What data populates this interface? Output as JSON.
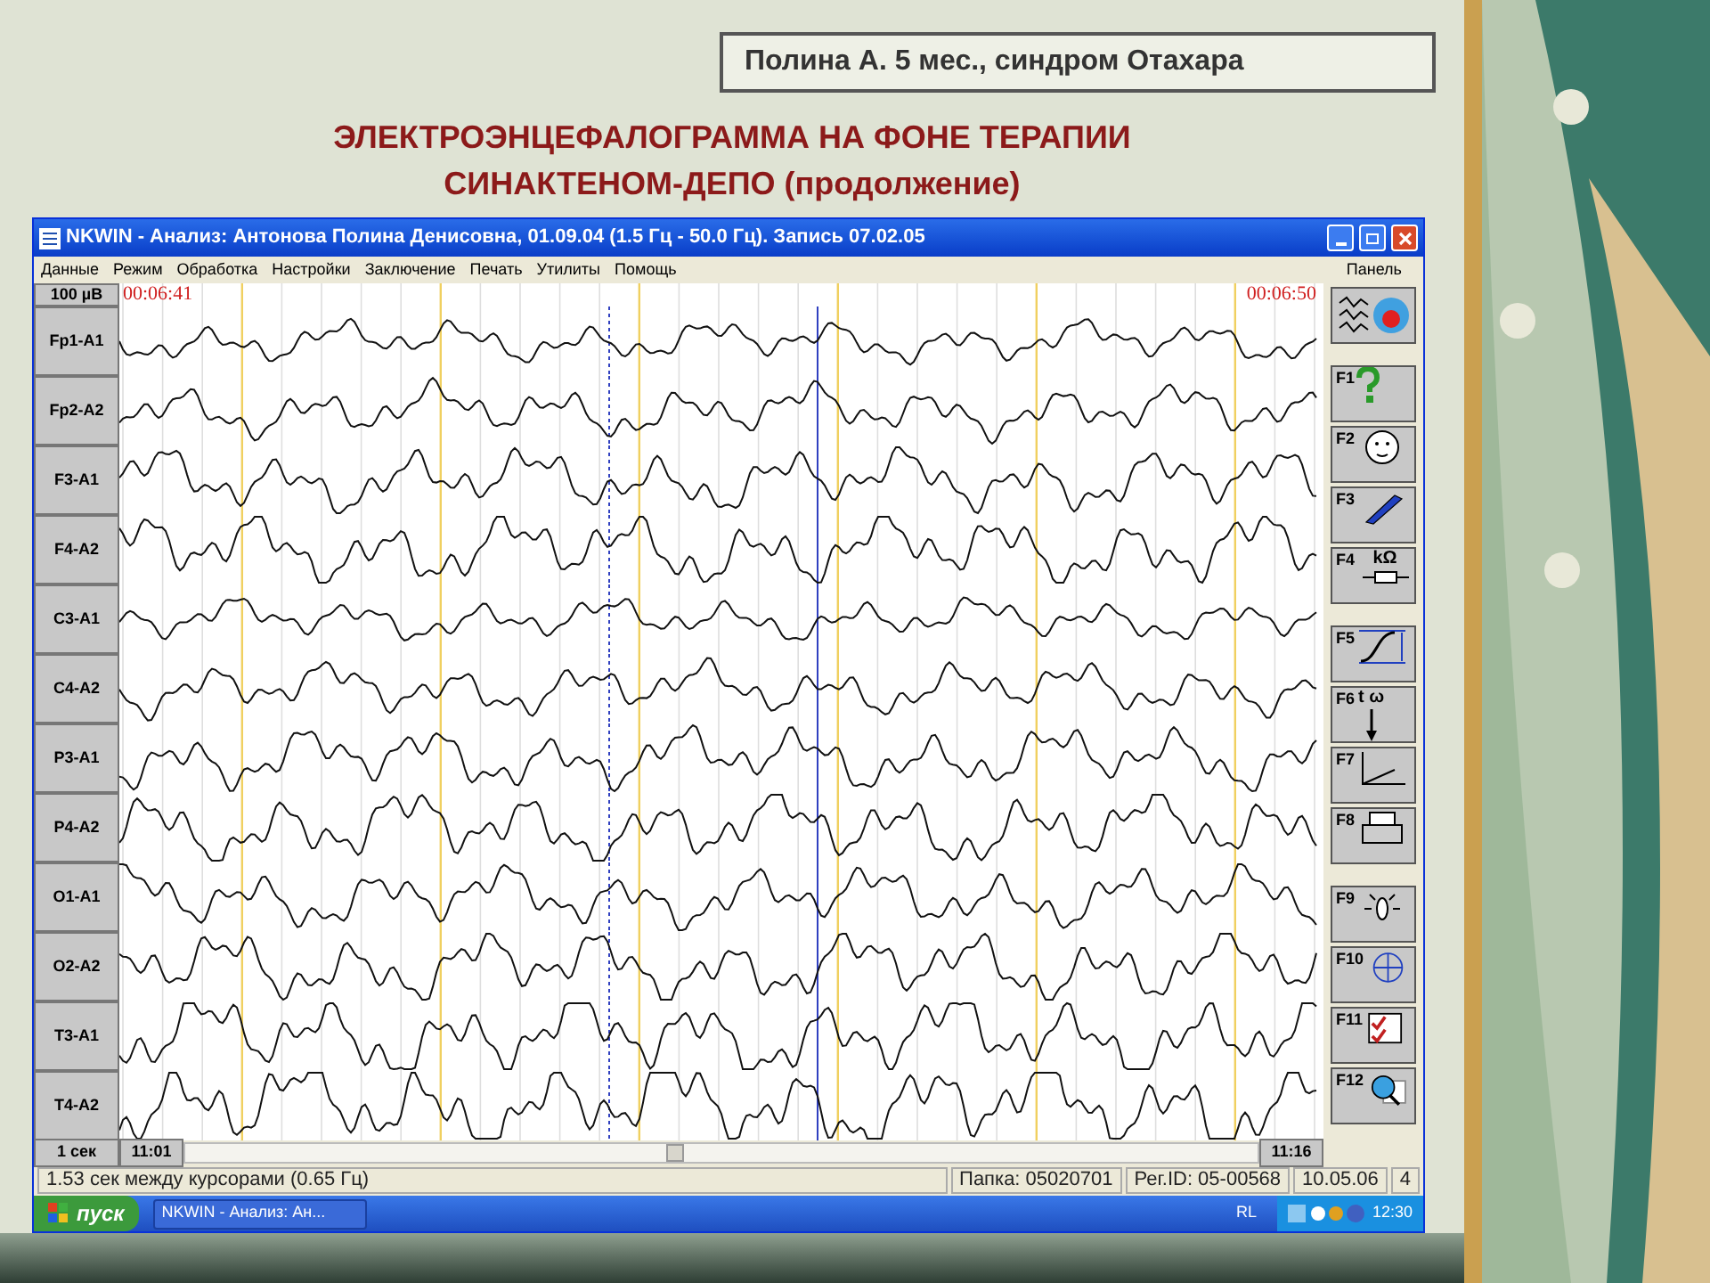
{
  "slide": {
    "caption": "Полина А. 5 мес., синдром Отахара",
    "title_lines": [
      "ЭЛЕКТРОЭНЦЕФАЛОГРАММА НА ФОНЕ ТЕРАПИИ",
      "СИНАКТЕНОМ-ДЕПО (продолжение)"
    ]
  },
  "window": {
    "title": "NKWIN - Анализ: Антонова Полина Денисовна, 01.09.04 (1.5 Гц - 50.0 Гц). Запись 07.02.05"
  },
  "menu": [
    "Данные",
    "Режим",
    "Обработка",
    "Настройки",
    "Заключение",
    "Печать",
    "Утилиты",
    "Помощь"
  ],
  "panel_label": "Панель",
  "scale": "100 µB",
  "time_start": "00:06:41",
  "time_end": "00:06:50",
  "channels": [
    "Fp1-A1",
    "Fp2-A2",
    "F3-A1",
    "F4-A2",
    "C3-A1",
    "C4-A2",
    "P3-A1",
    "P4-A2",
    "O1-A1",
    "O2-A2",
    "T3-A1",
    "T4-A2"
  ],
  "function_keys": [
    {
      "label": "F1",
      "kind": "help"
    },
    {
      "label": "F2",
      "kind": "face"
    },
    {
      "label": "F3",
      "kind": "pen"
    },
    {
      "label": "F4",
      "kind": "impedance",
      "icon_text": "kΩ"
    },
    {
      "label": "F5",
      "kind": "curve"
    },
    {
      "label": "F6",
      "kind": "timefreq",
      "icon_text": "t ω"
    },
    {
      "label": "F7",
      "kind": "axes"
    },
    {
      "label": "F8",
      "kind": "printer"
    },
    {
      "label": "F9",
      "kind": "light"
    },
    {
      "label": "F10",
      "kind": "globe"
    },
    {
      "label": "F11",
      "kind": "checklist"
    },
    {
      "label": "F12",
      "kind": "magnifier"
    }
  ],
  "timebase": "1 сек",
  "scroll_start": "11:01",
  "scroll_end": "11:16",
  "status": [
    "1.53 сек между курсорами (0.65 Гц)",
    "Папка: 05020701",
    "Рег.ID: 05-00568",
    "10.05.06",
    "4"
  ],
  "taskbar": {
    "start": "пуск",
    "tasks": [
      "NKWIN - Анализ: Ан..."
    ],
    "lang": "RL",
    "clock": "12:30"
  }
}
